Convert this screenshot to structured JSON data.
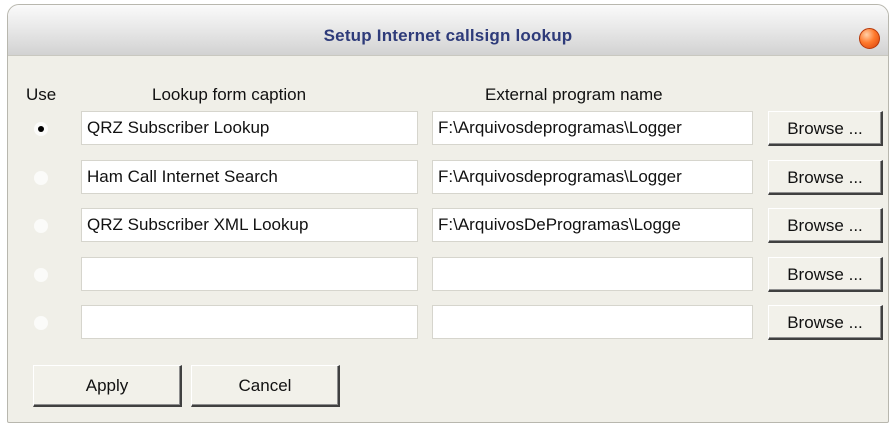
{
  "window": {
    "title": "Setup Internet callsign lookup"
  },
  "headers": {
    "use": "Use",
    "caption": "Lookup form caption",
    "program": "External program name"
  },
  "rows": [
    {
      "selected": true,
      "caption": "QRZ Subscriber Lookup",
      "program": "F:\\Arquivosdeprogramas\\Logger",
      "browse_label": "Browse ..."
    },
    {
      "selected": false,
      "caption": "Ham Call Internet Search",
      "program": "F:\\Arquivosdeprogramas\\Logger",
      "browse_label": "Browse ..."
    },
    {
      "selected": false,
      "caption": "QRZ Subscriber XML Lookup",
      "program": "F:\\ArquivosDeProgramas\\Logge",
      "browse_label": "Browse ..."
    },
    {
      "selected": false,
      "caption": "",
      "program": "",
      "browse_label": "Browse ..."
    },
    {
      "selected": false,
      "caption": "",
      "program": "",
      "browse_label": "Browse ..."
    }
  ],
  "buttons": {
    "apply": "Apply",
    "cancel": "Cancel"
  }
}
